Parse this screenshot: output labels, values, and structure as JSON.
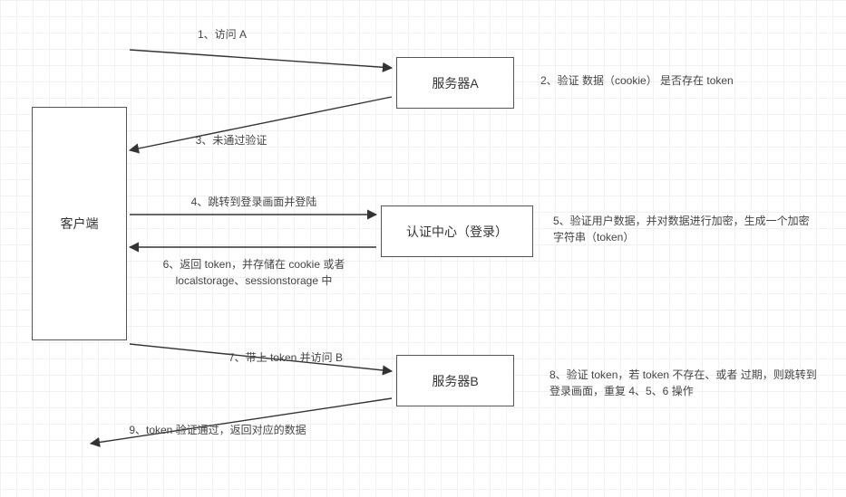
{
  "nodes": {
    "client": "客户端",
    "serverA": "服务器A",
    "auth": "认证中心（登录）",
    "serverB": "服务器B"
  },
  "edges": {
    "e1": "1、访问 A",
    "e2": "2、验证 数据（cookie） 是否存在 token",
    "e3": "3、未通过验证",
    "e4": "4、跳转到登录画面并登陆",
    "e5": "5、验证用户数据，并对数据进行加密，生成一个加密字符串（token）",
    "e6": "6、返回 token，并存储在 cookie 或者 localstorage、sessionstorage 中",
    "e7": "7、带上 token 并访问 B",
    "e8": "8、验证 token，若 token 不存在、或者 过期，则跳转到 登录画面，重复 4、5、6 操作",
    "e9": "9、token 验证通过，返回对应的数据"
  }
}
